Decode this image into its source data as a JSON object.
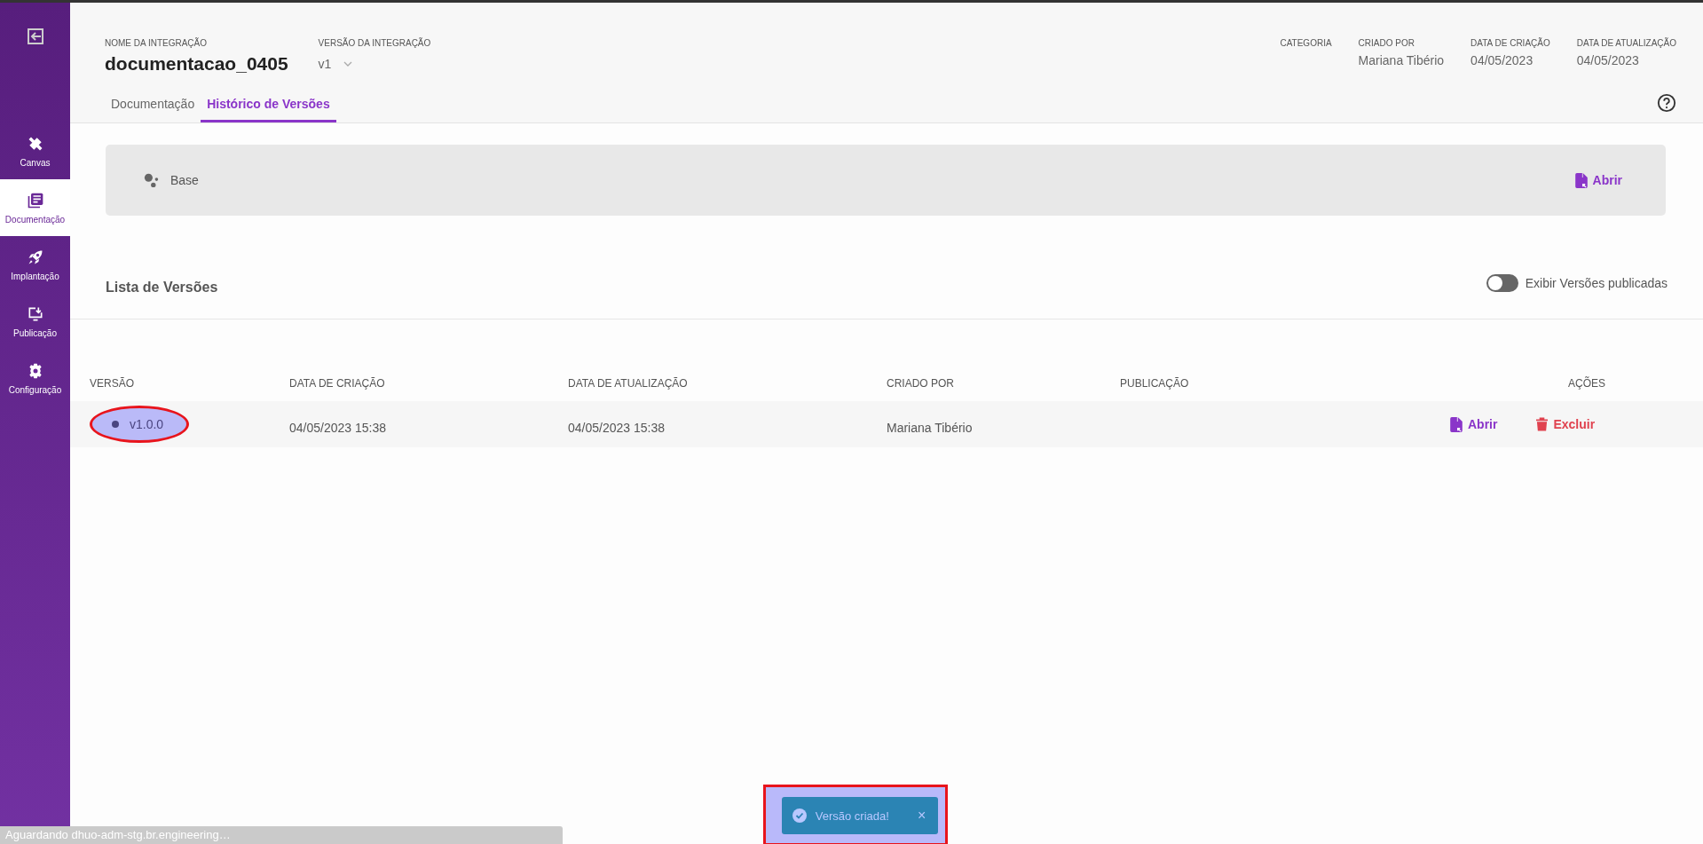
{
  "sidebar": {
    "items": [
      {
        "kind": "exit"
      },
      {
        "kind": "tools",
        "label": "Canvas",
        "selected": false
      },
      {
        "kind": "docs",
        "label": "Documentação",
        "selected": true
      },
      {
        "kind": "rocket",
        "label": "Implantação",
        "selected": false
      },
      {
        "kind": "publish",
        "label": "Publicação",
        "selected": false
      },
      {
        "kind": "gear",
        "label": "Configuração",
        "selected": false
      }
    ]
  },
  "header": {
    "fields": [
      {
        "label": "NOME DA INTEGRAÇÃO",
        "value": "documentacao_0405",
        "kind": "title"
      },
      {
        "label": "VERSÃO DA INTEGRAÇÃO",
        "value": "v1",
        "kind": "select"
      }
    ],
    "meta": [
      {
        "label": "CATEGORIA"
      },
      {
        "label": "CRIADO POR",
        "value": "Mariana Tibério"
      },
      {
        "label": "DATA DE CRIAÇÃO",
        "value": "04/05/2023"
      },
      {
        "label": "DATA DE ATUALIZAÇÃO",
        "value": "04/05/2023"
      }
    ],
    "tabs": [
      {
        "label": "Documentação",
        "selected": false
      },
      {
        "label": "Histórico de Versões",
        "selected": true
      }
    ]
  },
  "base": {
    "label": "Base",
    "action": "Abrir"
  },
  "versions": {
    "title": "Lista de Versões",
    "toggle": {
      "label": "Exibir Versões publicadas",
      "on": false
    },
    "columns": [
      "VERSÃO",
      "DATA DE CRIAÇÃO",
      "DATA DE ATUALIZAÇÃO",
      "CRIADO POR",
      "PUBLICAÇÃO",
      "AÇÕES"
    ],
    "rows": [
      {
        "version": "v1.0.0",
        "created": "04/05/2023 15:38",
        "updated": "04/05/2023 15:38",
        "author": "Mariana Tibério",
        "highlighted": true,
        "actions": [
          "Abrir",
          "Excluir"
        ]
      }
    ]
  },
  "toast": {
    "message": "Versão criada!",
    "close": "×",
    "highlighted": true
  },
  "status_bar": {
    "text": "Aguardando dhuo-adm-stg.br.engineering…"
  }
}
